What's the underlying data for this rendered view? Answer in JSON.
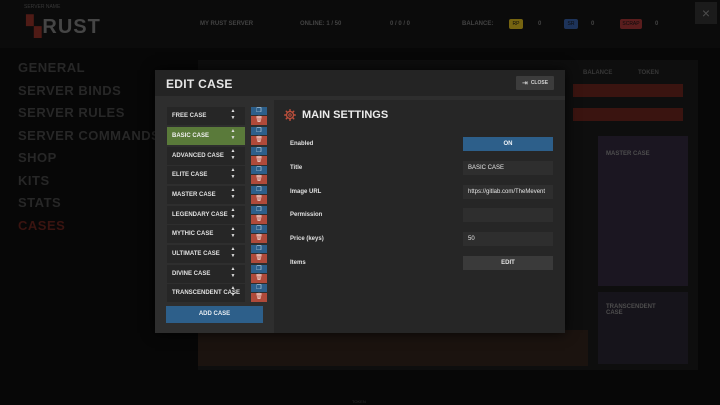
{
  "background": {
    "logo_small": "SERVER NAME",
    "logo": "RUST",
    "top_items": [
      "MY RUST SERVER",
      "ONLINE: 1 / 50",
      "0 / 0 / 0",
      "BALANCE:"
    ],
    "balance_badges": [
      {
        "label": "RP",
        "color": "#b59a1a"
      },
      {
        "label": "SR",
        "color": "#2d4f8a"
      },
      {
        "label": "SCRAP",
        "color": "#8a2d2d"
      }
    ],
    "close_glyph": "×",
    "nav": [
      "GENERAL",
      "SERVER BINDS",
      "SERVER RULES",
      "SERVER COMMANDS",
      "SHOP",
      "KITS",
      "STATS",
      "CASES"
    ],
    "active_nav": "CASES",
    "panel_labels": [
      "BALANCE",
      "TOKEN"
    ],
    "card_titles": [
      "MASTER CASE",
      "TRANSCENDENT CASE"
    ],
    "bottom_tag": "TOKEN"
  },
  "modal": {
    "title": "EDIT CASE",
    "close_label": "CLOSE",
    "cases": [
      {
        "name": "FREE CASE",
        "selected": false
      },
      {
        "name": "BASIC CASE",
        "selected": true
      },
      {
        "name": "ADVANCED CASE",
        "selected": false
      },
      {
        "name": "ELITE CASE",
        "selected": false
      },
      {
        "name": "MASTER CASE",
        "selected": false
      },
      {
        "name": "LEGENDARY CASE",
        "selected": false
      },
      {
        "name": "MYTHIC CASE",
        "selected": false
      },
      {
        "name": "ULTIMATE CASE",
        "selected": false
      },
      {
        "name": "DIVINE CASE",
        "selected": false
      },
      {
        "name": "TRANSCENDENT CASE",
        "selected": false
      }
    ],
    "add_case_label": "ADD CASE",
    "settings": {
      "title": "MAIN SETTINGS",
      "fields": {
        "enabled": {
          "label": "Enabled",
          "value": "ON"
        },
        "title": {
          "label": "Title",
          "value": "BASIC CASE"
        },
        "image_url": {
          "label": "Image URL",
          "value": "https://gitlab.com/TheMevent"
        },
        "permission": {
          "label": "Permission",
          "value": ""
        },
        "price": {
          "label": "Price (keys)",
          "value": "50"
        },
        "items": {
          "label": "Items",
          "value": "EDIT"
        }
      }
    }
  },
  "colors": {
    "selected_case": "#5a7a3a",
    "accent_blue": "#2d5f8a",
    "delete_red": "#b04a3a",
    "gear": "#c0503c"
  }
}
